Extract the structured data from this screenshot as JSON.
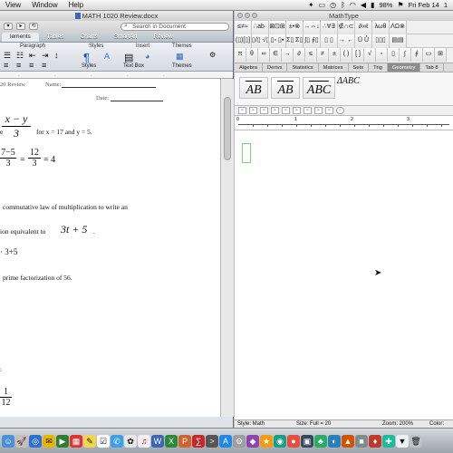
{
  "menubar": {
    "items": [
      "View",
      "Window",
      "Help"
    ],
    "battery": "98%",
    "clock": "Fri Feb 14",
    "right_trail": "1"
  },
  "word": {
    "title": "MATH 1020 Review.docx",
    "search_placeholder": "Search in Document",
    "tabs": [
      "lements",
      "Tables",
      "Charts",
      "SmartArt",
      "Review"
    ],
    "groups": {
      "paragraph": "Paragraph",
      "styles": "Styles",
      "insert": "Insert",
      "themes": "Themes"
    },
    "buttons": {
      "styles": "Styles",
      "textbox": "Text Box",
      "themes": "Themes"
    },
    "doc": {
      "header_course": "20 Review",
      "name_label": "Name:",
      "date_label": "Date:",
      "frac1_num": "x − y",
      "frac1_den": "3",
      "e_fragment": "e",
      "for_text": "for x = 17 and y =  5.",
      "eq_left_num": "7−5",
      "eq_left_den": "3",
      "eq_mid_num": "12",
      "eq_mid_den": "3",
      "eq_result": "= 4",
      "eq_sign": "=",
      "commutative": "commutative law of multiplication to write an",
      "equivalent": "ion equivalent to",
      "expr_3t5": "3t + 5",
      "period": ".",
      "answer_expr": "· 3+5",
      "prime": "prime factorization of 56.",
      "colon": ":",
      "bottom_num": "1",
      "bottom_den": "12"
    }
  },
  "mathtype": {
    "title": "MathType",
    "palette_row1": [
      "≤≠≈",
      "∴ab·",
      "⊠⊡⊞",
      "±•⊗",
      "→⇔↓",
      "∴∀∃",
      "∉∩⊂",
      "∂∞ℓ",
      "λωθ",
      "ΛΩ⊗"
    ],
    "palette_row2": [
      "(▯)[▯]",
      "▯/▯ √▯",
      "▯▫ ▯▪",
      "Σ▯ Σ▯",
      "∫▯ ∮▯",
      "▯ ▯",
      "→ ←",
      "Ū Ů",
      "▯▯▯",
      "▤▤"
    ],
    "palette_row3": [
      "π",
      "θ",
      "∞",
      "∈",
      "→",
      "∂",
      "≤",
      "≠",
      "±",
      "( )",
      "[ ]",
      "√",
      "▫",
      "▯",
      "∫",
      "∮",
      "▭",
      "⊞"
    ],
    "tabs": [
      "Algebra",
      "Derivs",
      "Statistics",
      "Matrices",
      "Sets",
      "Trig",
      "Geometry",
      "Tab 8"
    ],
    "active_tab": "Geometry",
    "templates": [
      "AB",
      "AB",
      "ABC",
      "ΔABC"
    ],
    "ruler_numbers": [
      "1",
      "2",
      "3"
    ],
    "status": {
      "style": "Style: Math",
      "size": "Size: Full = 20",
      "zoom": "Zoom: 200%",
      "color": "Color:"
    }
  }
}
